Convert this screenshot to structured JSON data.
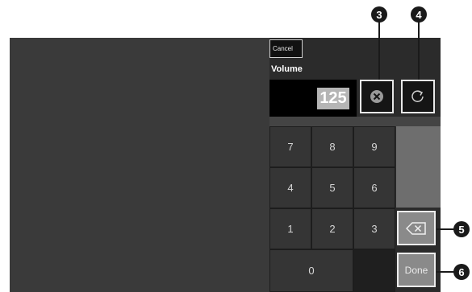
{
  "toolbar": {
    "cancel_label": "Cancel"
  },
  "field": {
    "label": "Volume",
    "value": "125"
  },
  "icons": {
    "clear": "circle-x-icon",
    "reset": "refresh-icon",
    "backspace": "backspace-icon"
  },
  "keypad": {
    "rows": [
      [
        "7",
        "8",
        "9"
      ],
      [
        "4",
        "5",
        "6"
      ],
      [
        "1",
        "2",
        "3"
      ]
    ],
    "zero": "0"
  },
  "actions": {
    "done_label": "Done"
  },
  "callouts": [
    "3",
    "4",
    "5",
    "6"
  ],
  "colors": {
    "screen_bg": "#2b2b2b",
    "key_bg": "#353535",
    "button_bg": "#8a8a8a",
    "callout": "#1a1a1a"
  }
}
